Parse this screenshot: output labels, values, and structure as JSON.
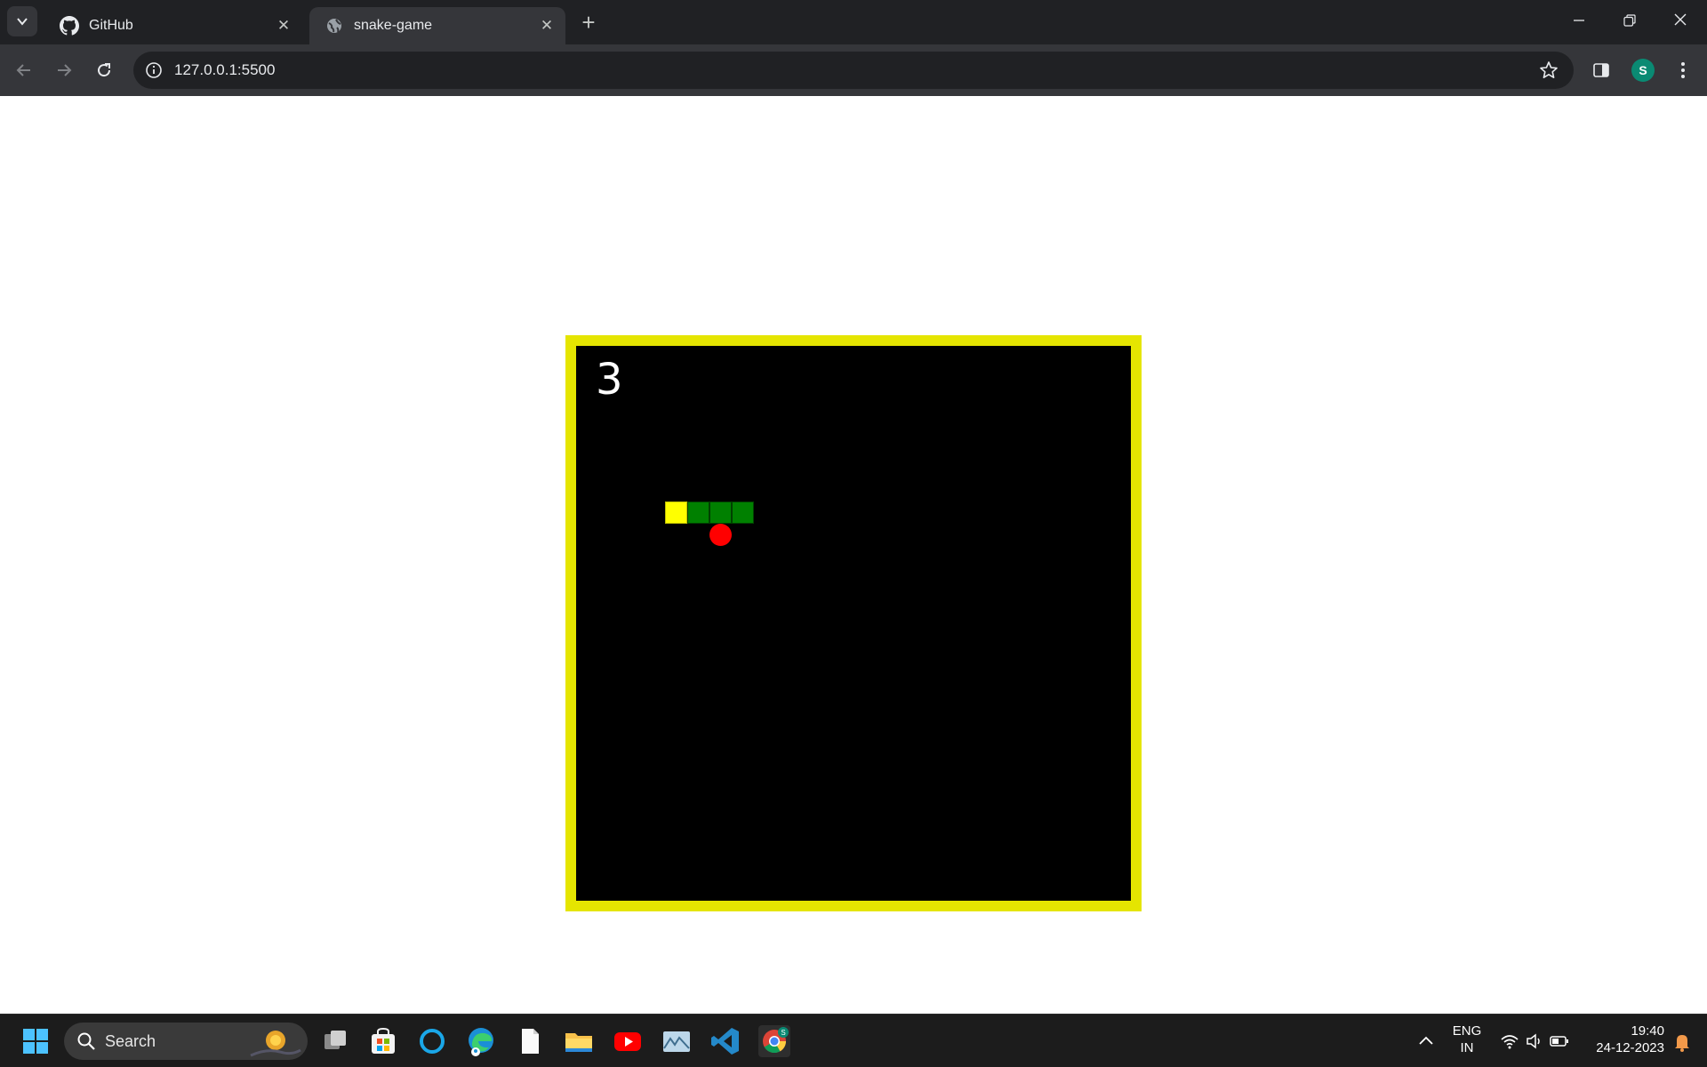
{
  "browser": {
    "tabs": [
      {
        "title": "GitHub",
        "active": false,
        "icon": "github-icon"
      },
      {
        "title": "snake-game",
        "active": true,
        "icon": "globe-icon"
      }
    ],
    "url": "127.0.0.1:5500",
    "profile_initial": "S"
  },
  "game": {
    "score": "3",
    "grid_cells": 25,
    "snake": [
      [
        4,
        7
      ],
      [
        5,
        7
      ],
      [
        6,
        7
      ],
      [
        7,
        7
      ]
    ],
    "food": [
      6,
      8
    ],
    "colors": {
      "border": "#e5e501",
      "board": "#000000",
      "head": "#ffff00",
      "body": "#008000",
      "food": "#ff0000"
    }
  },
  "taskbar": {
    "search_placeholder": "Search",
    "language_line1": "ENG",
    "language_line2": "IN",
    "time": "19:40",
    "date": "24-12-2023",
    "pinned_apps": [
      "task-view-icon",
      "microsoft-store-icon",
      "cortana-icon",
      "edge-icon",
      "notepad-icon",
      "file-explorer-icon",
      "youtube-icon",
      "photos-icon",
      "vscode-icon",
      "chrome-icon"
    ]
  }
}
